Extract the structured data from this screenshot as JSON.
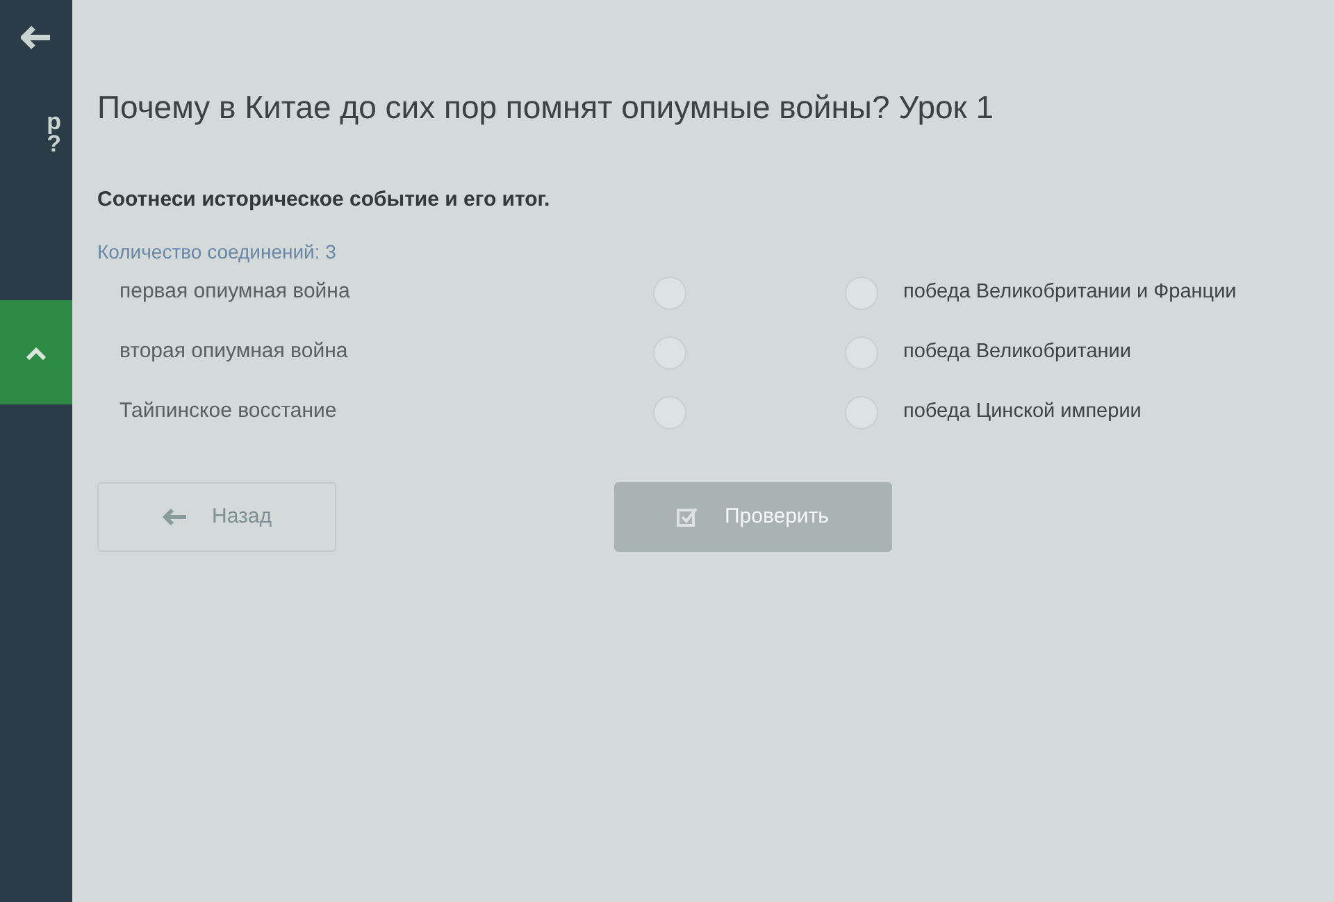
{
  "sidebar": {
    "lines": [
      "р",
      "?"
    ]
  },
  "title": "Почему в Китае до сих пор помнят опиумные войны? Урок 1",
  "task": {
    "instruction": "Соотнеси историческое событие и его итог.",
    "count": "Количество соединений: 3",
    "left": [
      "первая опиумная война",
      "вторая опиумная война",
      "Тайпинское восстание"
    ],
    "right": [
      "победа Великобритании и Франции",
      "победа Великобритании",
      "победа Цинской империи"
    ]
  },
  "buttons": [
    {
      "kind": "back",
      "label": "Назад",
      "disabled": false
    },
    {
      "kind": "check",
      "label": "Проверить",
      "disabled": true
    }
  ]
}
